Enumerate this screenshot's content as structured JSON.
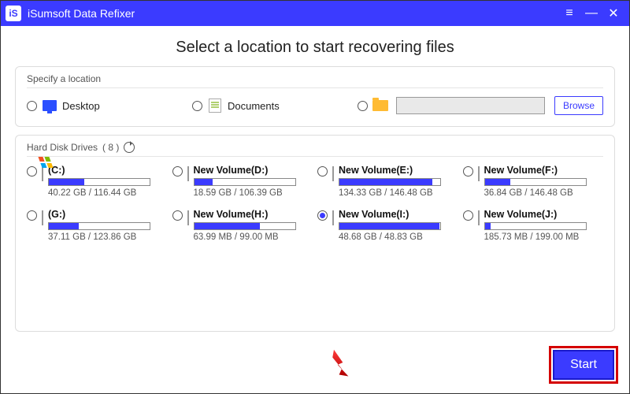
{
  "app": {
    "title": "iSumsoft Data Refixer"
  },
  "heading": "Select a location to start recovering files",
  "locations": {
    "panelTitle": "Specify a location",
    "desktop": "Desktop",
    "documents": "Documents",
    "browse": "Browse",
    "customPath": ""
  },
  "drivesPanel": {
    "titlePrefix": "Hard Disk Drives",
    "count": "( 8 )"
  },
  "drives": [
    {
      "name": "(C:)",
      "size": "40.22 GB / 116.44 GB",
      "fill": 35,
      "selected": false,
      "win": true
    },
    {
      "name": "New Volume(D:)",
      "size": "18.59 GB / 106.39 GB",
      "fill": 18,
      "selected": false,
      "win": false
    },
    {
      "name": "New Volume(E:)",
      "size": "134.33 GB / 146.48 GB",
      "fill": 92,
      "selected": false,
      "win": false
    },
    {
      "name": "New Volume(F:)",
      "size": "36.84 GB / 146.48 GB",
      "fill": 25,
      "selected": false,
      "win": false
    },
    {
      "name": "(G:)",
      "size": "37.11 GB / 123.86 GB",
      "fill": 30,
      "selected": false,
      "win": false
    },
    {
      "name": "New Volume(H:)",
      "size": "63.99 MB / 99.00 MB",
      "fill": 65,
      "selected": false,
      "win": false
    },
    {
      "name": "New Volume(I:)",
      "size": "48.68 GB / 48.83 GB",
      "fill": 99,
      "selected": true,
      "win": false
    },
    {
      "name": "New Volume(J:)",
      "size": "185.73 MB / 199.00 MB",
      "fill": 6,
      "selected": false,
      "win": false
    }
  ],
  "footer": {
    "start": "Start"
  }
}
